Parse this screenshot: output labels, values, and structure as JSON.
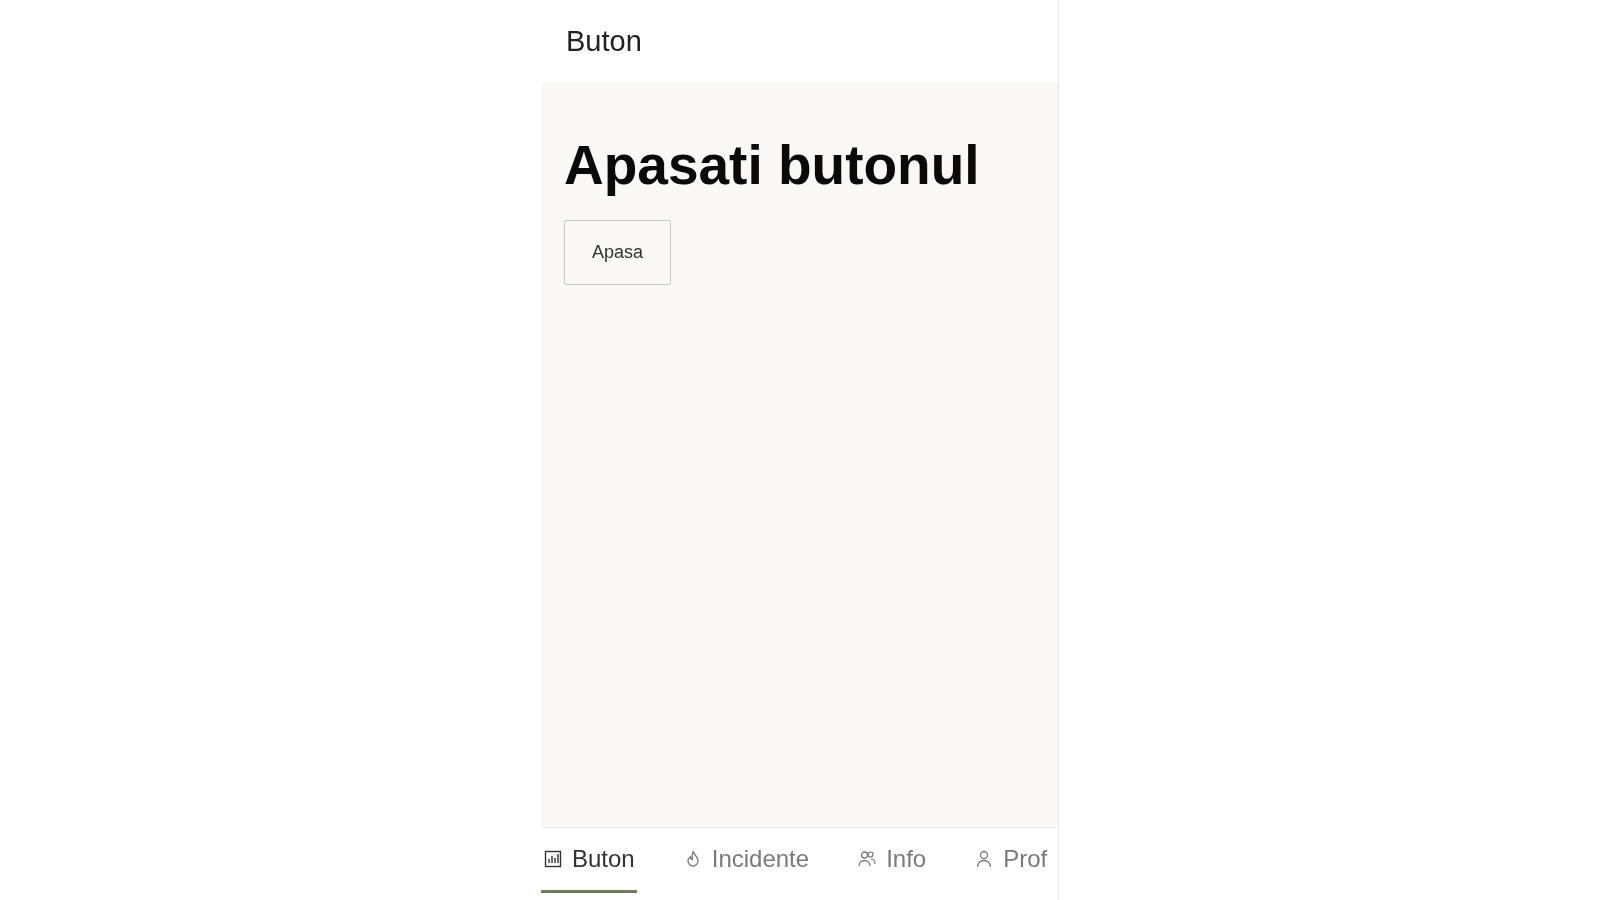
{
  "header": {
    "title": "Buton"
  },
  "content": {
    "heading": "Apasati butonul",
    "button": {
      "label": "Apasa"
    }
  },
  "tab_bar": {
    "tabs": [
      {
        "label": "Buton",
        "selected": true
      },
      {
        "label": "Incidente",
        "selected": false
      },
      {
        "label": "Info",
        "selected": false
      },
      {
        "label": "Prof",
        "selected": false
      }
    ]
  }
}
